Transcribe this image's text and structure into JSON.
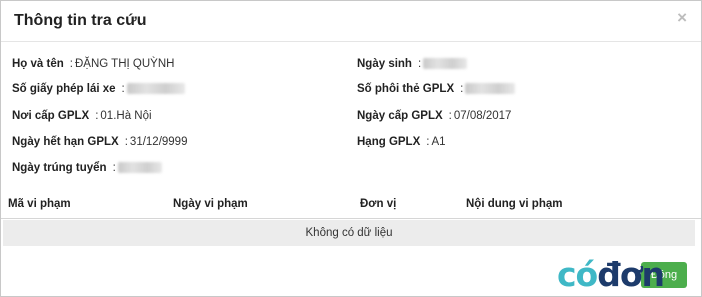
{
  "dialog": {
    "title": "Thông tin tra cứu",
    "close_symbol": "×"
  },
  "fields": {
    "ho_va_ten": {
      "label": "Họ và tên",
      "value": "ĐẶNG THỊ QUỲNH"
    },
    "ngay_sinh": {
      "label": "Ngày sinh",
      "value": ""
    },
    "so_giay_phep": {
      "label": "Số giấy phép lái xe",
      "value": ""
    },
    "so_phoi_the": {
      "label": "Số phôi thẻ GPLX",
      "value": ""
    },
    "noi_cap": {
      "label": "Nơi cấp GPLX",
      "value": "01.Hà Nội"
    },
    "ngay_cap": {
      "label": "Ngày cấp GPLX",
      "value": "07/08/2017"
    },
    "ngay_het_han": {
      "label": "Ngày hết hạn GPLX",
      "value": "31/12/9999"
    },
    "hang": {
      "label": "Hạng GPLX",
      "value": "A1"
    },
    "ngay_trung_tuyen": {
      "label": "Ngày trúng tuyển",
      "value": ""
    }
  },
  "separator": ":",
  "violations_table": {
    "headers": [
      "Mã vi phạm",
      "Ngày vi phạm",
      "Đơn vị",
      "Nội dung vi phạm"
    ],
    "empty_text": "Không có dữ liệu"
  },
  "footer": {
    "button_label": "Đóng"
  },
  "watermark": {
    "part1": "có",
    "part2": "đơn"
  }
}
